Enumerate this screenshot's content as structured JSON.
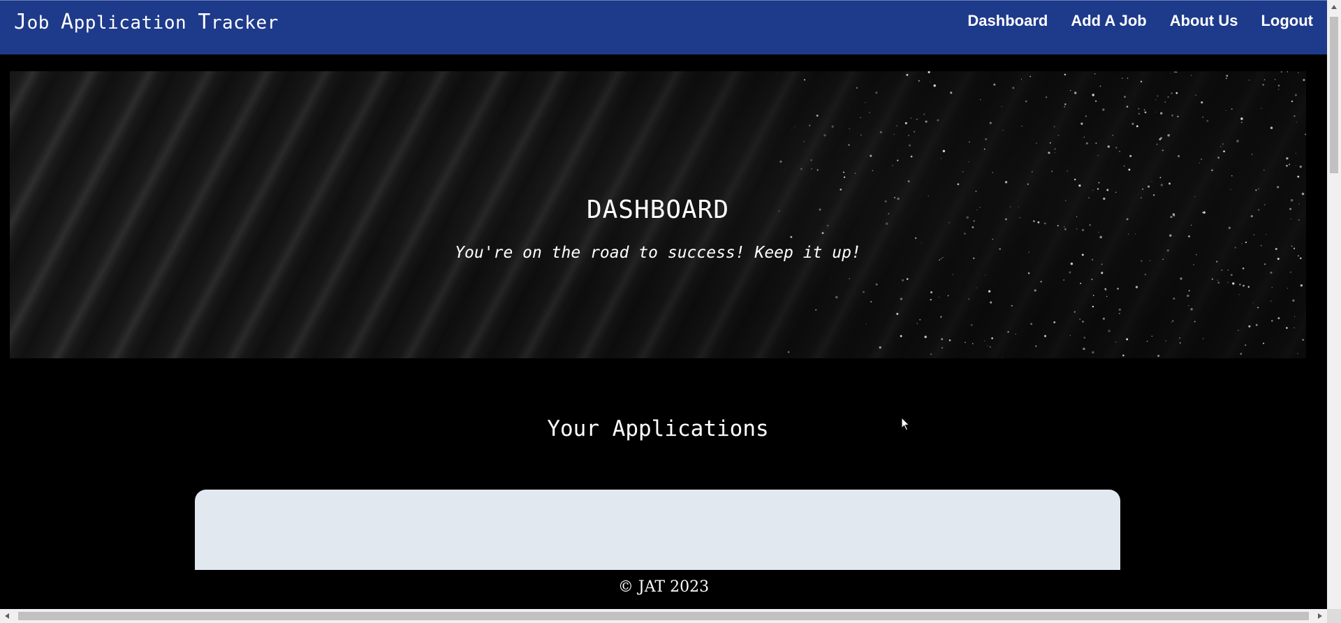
{
  "navbar": {
    "brand_parts": [
      "J",
      "ob ",
      "A",
      "pplication ",
      "T",
      "racker"
    ],
    "links": [
      {
        "label": "Dashboard"
      },
      {
        "label": "Add A Job"
      },
      {
        "label": "About Us"
      },
      {
        "label": "Logout"
      }
    ],
    "background_color": "#1e3a8a"
  },
  "hero": {
    "title": "DASHBOARD",
    "subtitle": "You're on the road to success! Keep it up!"
  },
  "applications": {
    "title": "Your Applications",
    "panel_color": "#e2e8f0"
  },
  "footer": {
    "text": "© JAT 2023"
  }
}
